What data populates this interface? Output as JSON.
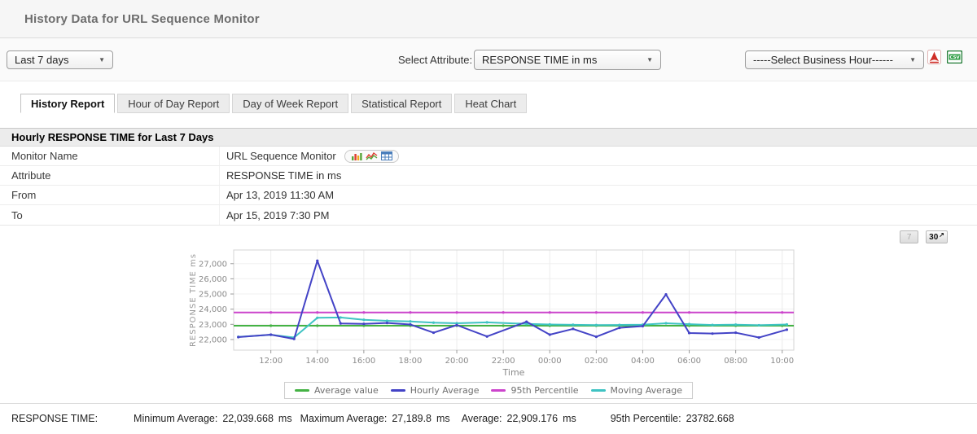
{
  "page_title": "History Data for URL Sequence Monitor",
  "toolbar": {
    "time_range_value": "Last 7 days",
    "attribute_label": "Select Attribute:",
    "attribute_value": "RESPONSE TIME in ms",
    "business_hour_value": "-----Select Business Hour------",
    "export_icons": [
      "pdf-icon",
      "csv-icon"
    ]
  },
  "tabs": [
    {
      "label": "History Report",
      "active": true
    },
    {
      "label": "Hour of Day Report",
      "active": false
    },
    {
      "label": "Day of Week Report",
      "active": false
    },
    {
      "label": "Statistical Report",
      "active": false
    },
    {
      "label": "Heat Chart",
      "active": false
    }
  ],
  "report_table": {
    "title": "Hourly RESPONSE TIME for Last 7 Days",
    "rows": [
      {
        "label": "Monitor Name",
        "value": "URL Sequence Monitor",
        "has_chart_icons": true,
        "icons": [
          "bar-chart-icon",
          "line-chart-icon",
          "data-table-icon"
        ]
      },
      {
        "label": "Attribute",
        "value": "RESPONSE TIME in ms",
        "has_chart_icons": false
      },
      {
        "label": "From",
        "value": "Apr 13, 2019 11:30 AM",
        "has_chart_icons": false
      },
      {
        "label": "To",
        "value": "Apr 15, 2019 7:30 PM",
        "has_chart_icons": false
      }
    ]
  },
  "period_buttons": [
    {
      "label": "7",
      "enabled": false,
      "arrow": ""
    },
    {
      "label": "30",
      "enabled": true,
      "arrow": "↗"
    }
  ],
  "chart_data": {
    "type": "line",
    "title": "",
    "xlabel": "Time",
    "ylabel": "RESPONSE TIME ms",
    "xlim": [
      10.4,
      34.5
    ],
    "ylim": [
      21300,
      27900
    ],
    "xticks": [
      12,
      14,
      16,
      18,
      20,
      22,
      24,
      26,
      28,
      30,
      32,
      34
    ],
    "xtick_labels": [
      "12:00",
      "14:00",
      "16:00",
      "18:00",
      "20:00",
      "22:00",
      "00:00",
      "02:00",
      "04:00",
      "06:00",
      "08:00",
      "10:00"
    ],
    "yticks": [
      22000,
      23000,
      24000,
      25000,
      26000,
      27000
    ],
    "grid": true,
    "legend_position": "bottom",
    "draw_order": [
      0,
      2,
      3,
      1
    ],
    "series": [
      {
        "name": "Average value",
        "color": "#44b244",
        "constant": 22909.176
      },
      {
        "name": "Hourly Average",
        "color": "#4343c6",
        "points": [
          [
            10.6,
            22160
          ],
          [
            12.0,
            22320
          ],
          [
            13.0,
            22040
          ],
          [
            14.0,
            27190
          ],
          [
            15.0,
            23060
          ],
          [
            16.0,
            23030
          ],
          [
            17.0,
            23090
          ],
          [
            18.0,
            22990
          ],
          [
            19.0,
            22450
          ],
          [
            20.0,
            22950
          ],
          [
            21.3,
            22200
          ],
          [
            23.0,
            23170
          ],
          [
            24.0,
            22320
          ],
          [
            25.0,
            22700
          ],
          [
            26.0,
            22180
          ],
          [
            27.0,
            22770
          ],
          [
            28.0,
            22880
          ],
          [
            29.0,
            24970
          ],
          [
            30.0,
            22430
          ],
          [
            31.0,
            22390
          ],
          [
            32.0,
            22450
          ],
          [
            33.0,
            22130
          ],
          [
            34.2,
            22650
          ]
        ]
      },
      {
        "name": "95th Percentile",
        "color": "#cc44cc",
        "constant": 23782.668
      },
      {
        "name": "Moving Average",
        "color": "#3fc3c3",
        "points": [
          [
            10.6,
            22170
          ],
          [
            12.0,
            22310
          ],
          [
            13.0,
            22130
          ],
          [
            14.0,
            23430
          ],
          [
            15.0,
            23450
          ],
          [
            16.0,
            23300
          ],
          [
            17.0,
            23230
          ],
          [
            18.0,
            23190
          ],
          [
            19.0,
            23110
          ],
          [
            20.0,
            23070
          ],
          [
            21.3,
            23130
          ],
          [
            23.0,
            23030
          ],
          [
            24.0,
            22990
          ],
          [
            25.0,
            22970
          ],
          [
            26.0,
            22950
          ],
          [
            27.0,
            22960
          ],
          [
            28.0,
            22980
          ],
          [
            29.0,
            23070
          ],
          [
            30.0,
            23010
          ],
          [
            31.0,
            22960
          ],
          [
            32.0,
            22980
          ],
          [
            33.0,
            22940
          ],
          [
            34.2,
            22990
          ]
        ]
      }
    ]
  },
  "summary": {
    "title": "RESPONSE TIME:",
    "items": [
      {
        "label": "Minimum Average:",
        "value": "22,039.668",
        "unit": "ms"
      },
      {
        "label": "Maximum Average:",
        "value": "27,189.8",
        "unit": "ms"
      },
      {
        "label": "Average:",
        "value": "22,909.176",
        "unit": "ms"
      },
      {
        "label": "95th Percentile:",
        "value": "23782.668",
        "unit": ""
      }
    ]
  }
}
